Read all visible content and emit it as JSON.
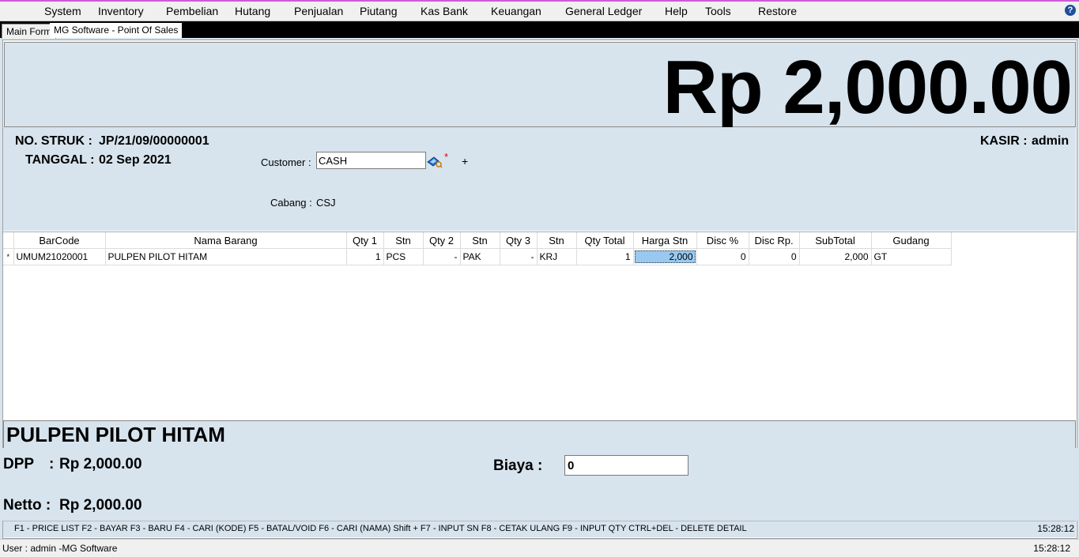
{
  "menu": [
    {
      "label": "System"
    },
    {
      "label": "Inventory"
    },
    {
      "label": "Pembelian"
    },
    {
      "label": "Hutang"
    },
    {
      "label": "Penjualan"
    },
    {
      "label": "Piutang"
    },
    {
      "label": "Kas Bank"
    },
    {
      "label": "Keuangan"
    },
    {
      "label": "General Ledger"
    },
    {
      "label": "Help"
    },
    {
      "label": "Tools"
    },
    {
      "label": "Restore"
    }
  ],
  "help_icon": "?",
  "tabs": [
    {
      "label": "Main Form"
    },
    {
      "label": "MG Software - Point Of Sales"
    }
  ],
  "total": "Rp 2,000.00",
  "header": {
    "no_struk_label": "NO. STRUK :",
    "no_struk_value": "JP/21/09/00000001",
    "tanggal_label": "TANGGAL :",
    "tanggal_value": "02 Sep 2021",
    "kasir_label": "KASIR :",
    "kasir_value": "admin",
    "customer_label": "Customer :",
    "customer_value": "CASH",
    "required_mark": "*",
    "add_label": "+",
    "cabang_label": "Cabang :",
    "cabang_value": "CSJ",
    "lookup_icon": "customer-lookup-icon"
  },
  "grid": {
    "columns": [
      "BarCode",
      "Nama Barang",
      "Qty 1",
      "Stn",
      "Qty 2",
      "Stn",
      "Qty 3",
      "Stn",
      "Qty Total",
      "Harga Stn",
      "Disc %",
      "Disc Rp.",
      "SubTotal",
      "Gudang"
    ],
    "rows": [
      {
        "marker": "*",
        "barcode": "UMUM21020001",
        "nama": "PULPEN PILOT HITAM",
        "qty1": "1",
        "stn1": "PCS",
        "qty2": "-",
        "stn2": "PAK",
        "qty3": "-",
        "stn3": "KRJ",
        "qty_total": "1",
        "harga": "2,000",
        "disc_pct": "0",
        "disc_rp": "0",
        "subtotal": "2,000",
        "gudang": "GT"
      }
    ]
  },
  "selected_item": "PULPEN PILOT HITAM",
  "summary": {
    "dpp_label": "DPP",
    "dpp_sep": ":",
    "dpp_value": "Rp 2,000.00",
    "netto_label": "Netto :",
    "netto_value": "Rp 2,000.00",
    "biaya_label": "Biaya :",
    "biaya_value": "0"
  },
  "shortcuts": "F1 - PRICE LIST  F2 - BAYAR  F3 - BARU  F4 - CARI (KODE)  F5 - BATAL/VOID  F6 - CARI (NAMA)  Shift + F7 - INPUT SN  F8 - CETAK ULANG  F9 - INPUT QTY  CTRL+DEL - DELETE DETAIL",
  "shortcut_time": "15:28:12",
  "status": {
    "user": "User : admin -MG Software",
    "time": "15:28:12"
  },
  "colors": {
    "panel": "#d7e4ee",
    "selection": "#99c9f0",
    "menu_accent": "#d05ad8"
  }
}
